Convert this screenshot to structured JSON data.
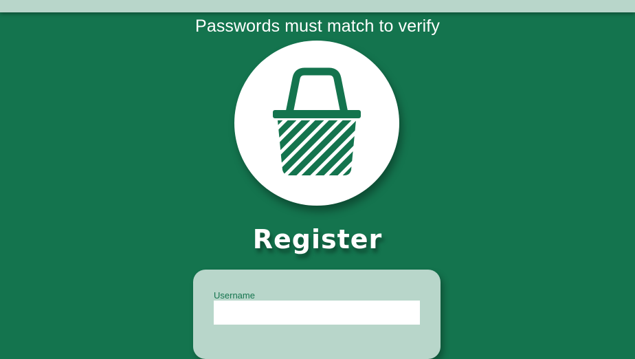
{
  "header": {
    "hint_text": "Passwords must match to verify"
  },
  "logo": {
    "icon": "basket-icon",
    "color": "#14744e"
  },
  "page": {
    "title": "Register"
  },
  "form": {
    "username": {
      "label": "Username",
      "value": "",
      "placeholder": ""
    }
  },
  "colors": {
    "background": "#14744e",
    "accent_light": "#b8d6ca",
    "white": "#ffffff"
  }
}
